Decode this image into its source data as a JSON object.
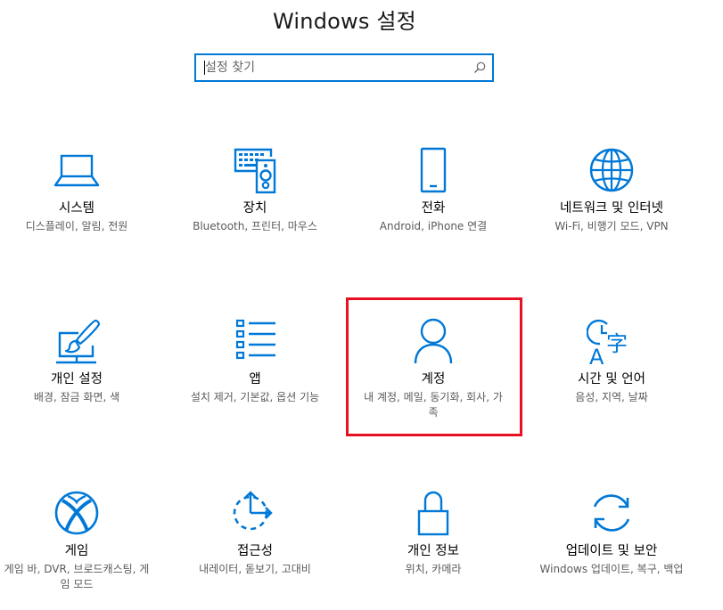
{
  "window": {
    "title": "Windows 설정"
  },
  "search": {
    "placeholder": "설정 찾기"
  },
  "accent_color": "#0078d7",
  "highlight_color": "#e81123",
  "tiles": [
    {
      "id": "system",
      "icon": "laptop-icon",
      "label": "시스템",
      "desc": "디스플레이, 알림, 전원"
    },
    {
      "id": "devices",
      "icon": "keyboard-speaker-icon",
      "label": "장치",
      "desc": "Bluetooth, 프린터, 마우스"
    },
    {
      "id": "phone",
      "icon": "phone-icon",
      "label": "전화",
      "desc": "Android, iPhone 연결"
    },
    {
      "id": "network",
      "icon": "globe-icon",
      "label": "네트워크 및 인터넷",
      "desc": "Wi-Fi, 비행기 모드, VPN"
    },
    {
      "id": "personalization",
      "icon": "paintbrush-icon",
      "label": "개인 설정",
      "desc": "배경, 잠금 화면, 색"
    },
    {
      "id": "apps",
      "icon": "apps-list-icon",
      "label": "앱",
      "desc": "설치 제거, 기본값, 옵션 기능"
    },
    {
      "id": "accounts",
      "icon": "person-icon",
      "label": "계정",
      "desc": "내 계정, 메일, 동기화, 회사, 가족"
    },
    {
      "id": "time-language",
      "icon": "time-language-icon",
      "label": "시간 및 언어",
      "desc": "음성, 지역, 날짜"
    },
    {
      "id": "gaming",
      "icon": "xbox-icon",
      "label": "게임",
      "desc": "게임 바, DVR, 브로드캐스팅, 게임 모드"
    },
    {
      "id": "ease-of-access",
      "icon": "ease-of-access-icon",
      "label": "접근성",
      "desc": "내레이터, 돋보기, 고대비"
    },
    {
      "id": "privacy",
      "icon": "lock-icon",
      "label": "개인 정보",
      "desc": "위치, 카메라"
    },
    {
      "id": "update-security",
      "icon": "sync-icon",
      "label": "업데이트 및 보안",
      "desc": "Windows 업데이트, 복구, 백업"
    }
  ]
}
